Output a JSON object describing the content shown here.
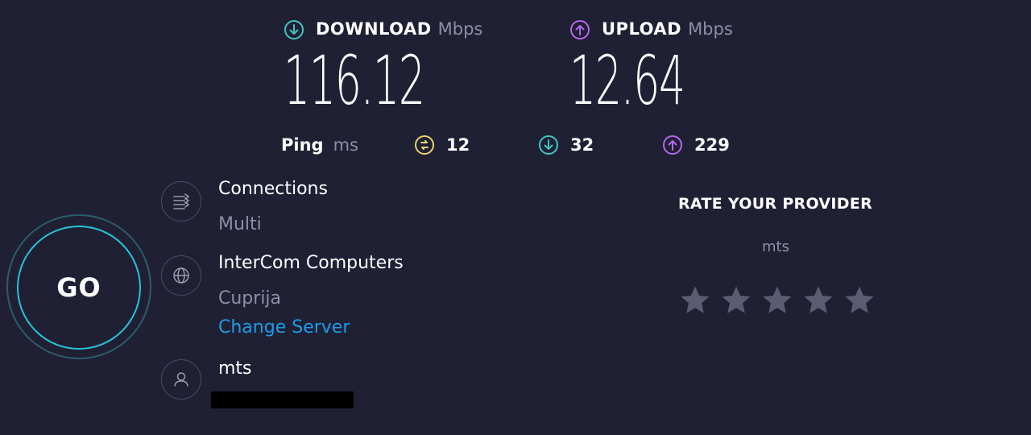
{
  "download": {
    "label": "DOWNLOAD",
    "unit": "Mbps",
    "value": "116.12",
    "icon": "download-arrow-icon",
    "color": "#3fc6bf"
  },
  "upload": {
    "label": "UPLOAD",
    "unit": "Mbps",
    "value": "12.64",
    "icon": "upload-arrow-icon",
    "color": "#b469e8"
  },
  "ping": {
    "label": "Ping",
    "unit": "ms",
    "idle": {
      "value": "12",
      "icon": "idle-ping-icon",
      "color": "#e7d36d"
    },
    "download": {
      "value": "32",
      "icon": "download-ping-icon",
      "color": "#3fc6bf"
    },
    "upload": {
      "value": "229",
      "icon": "upload-ping-icon",
      "color": "#b469e8"
    }
  },
  "go_button": {
    "label": "GO"
  },
  "connections": {
    "title": "Connections",
    "value": "Multi",
    "icon": "connections-icon"
  },
  "server": {
    "name": "InterCom Computers",
    "location": "Cuprija",
    "change_label": "Change Server",
    "icon": "globe-icon"
  },
  "provider": {
    "name": "mts",
    "icon": "user-icon"
  },
  "rate": {
    "title": "RATE YOUR PROVIDER",
    "isp": "mts",
    "stars_total": 5,
    "stars_selected": 0,
    "star_color": "#5b5c71"
  }
}
